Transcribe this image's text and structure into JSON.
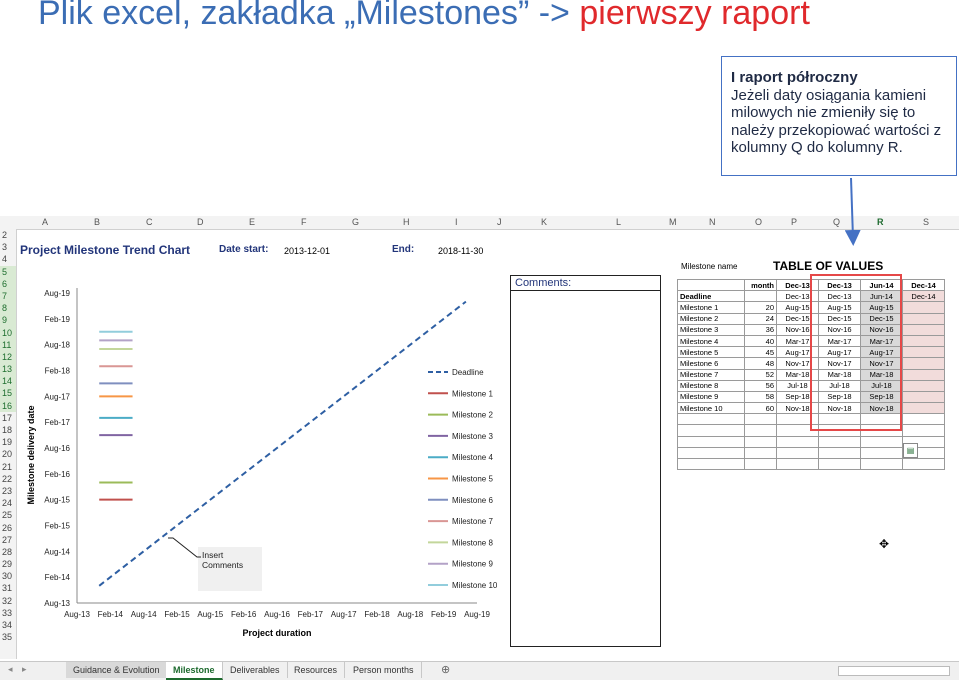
{
  "slide": {
    "title_part1": "Plik excel, zakładka „Milestones” -> ",
    "title_part2": "pierwszy raport"
  },
  "callout": {
    "heading": "I raport półroczny",
    "body": "Jeżeli daty osiągania kamieni milowych nie zmieniły się to należy przekopiować wartości z kolumny Q do kolumny R."
  },
  "columns": [
    "A",
    "B",
    "C",
    "D",
    "E",
    "F",
    "G",
    "H",
    "I",
    "J",
    "K",
    "L",
    "M",
    "N",
    "O",
    "P",
    "Q",
    "R",
    "S"
  ],
  "rows": [
    "2",
    "3",
    "4",
    "5",
    "6",
    "7",
    "8",
    "9",
    "10",
    "11",
    "12",
    "13",
    "14",
    "15",
    "16",
    "17",
    "18",
    "19",
    "20",
    "21",
    "22",
    "23",
    "24",
    "25",
    "26",
    "27",
    "28",
    "29",
    "30",
    "31",
    "32",
    "33",
    "34",
    "35"
  ],
  "sheet": {
    "chart_title": "Project Milestone Trend Chart",
    "date_start_label": "Date start:",
    "date_start_value": "2013-12-01",
    "end_label": "End:",
    "end_value": "2018-11-30",
    "comments_label": "Comments:",
    "milestone_name_label": "Milestone name",
    "table_title": "TABLE OF VALUES",
    "insert_comments": "Insert Comments"
  },
  "table": {
    "header": [
      "",
      "month",
      "Dec-13",
      "Dec-13",
      "Jun-14",
      "Dec-14"
    ],
    "rows": [
      {
        "name": "Deadline",
        "month": "",
        "c1": "Dec-13",
        "c2": "Dec-13",
        "c3": "Jun-14",
        "c4": "Dec-14"
      },
      {
        "name": "Milestone 1",
        "month": "20",
        "c1": "Aug-15",
        "c2": "Aug-15",
        "c3": "Aug-15",
        "c4": ""
      },
      {
        "name": "Milestone 2",
        "month": "24",
        "c1": "Dec-15",
        "c2": "Dec-15",
        "c3": "Dec-15",
        "c4": ""
      },
      {
        "name": "Milestone 3",
        "month": "36",
        "c1": "Nov-16",
        "c2": "Nov-16",
        "c3": "Nov-16",
        "c4": ""
      },
      {
        "name": "Milestone 4",
        "month": "40",
        "c1": "Mar-17",
        "c2": "Mar-17",
        "c3": "Mar-17",
        "c4": ""
      },
      {
        "name": "Milestone 5",
        "month": "45",
        "c1": "Aug-17",
        "c2": "Aug-17",
        "c3": "Aug-17",
        "c4": ""
      },
      {
        "name": "Milestone 6",
        "month": "48",
        "c1": "Nov-17",
        "c2": "Nov-17",
        "c3": "Nov-17",
        "c4": ""
      },
      {
        "name": "Milestone 7",
        "month": "52",
        "c1": "Mar-18",
        "c2": "Mar-18",
        "c3": "Mar-18",
        "c4": ""
      },
      {
        "name": "Milestone 8",
        "month": "56",
        "c1": "Jul-18",
        "c2": "Jul-18",
        "c3": "Jul-18",
        "c4": ""
      },
      {
        "name": "Milestone 9",
        "month": "58",
        "c1": "Sep-18",
        "c2": "Sep-18",
        "c3": "Sep-18",
        "c4": ""
      },
      {
        "name": "Milestone 10",
        "month": "60",
        "c1": "Nov-18",
        "c2": "Nov-18",
        "c3": "Nov-18",
        "c4": ""
      }
    ]
  },
  "chart_data": {
    "type": "line",
    "xlabel": "Project duration",
    "ylabel": "Milestone delivery date",
    "x_ticks": [
      "Aug-13",
      "Feb-14",
      "Aug-14",
      "Feb-15",
      "Aug-15",
      "Feb-16",
      "Aug-16",
      "Feb-17",
      "Aug-17",
      "Feb-18",
      "Aug-18",
      "Feb-19",
      "Aug-19"
    ],
    "y_ticks": [
      "Aug-13",
      "Feb-14",
      "Aug-14",
      "Feb-15",
      "Aug-15",
      "Feb-16",
      "Aug-16",
      "Feb-17",
      "Aug-17",
      "Feb-18",
      "Aug-18",
      "Feb-19",
      "Aug-19"
    ],
    "series": [
      {
        "name": "Deadline",
        "color": "#2e5fa3",
        "style": "dashed",
        "points": [
          [
            "Dec-13",
            "Dec-13"
          ],
          [
            "Jun-19",
            "Jun-19"
          ]
        ]
      },
      {
        "name": "Milestone 1",
        "color": "#c0504d",
        "points": [
          [
            "Dec-13",
            "Aug-15"
          ],
          [
            "Jun-14",
            "Aug-15"
          ]
        ]
      },
      {
        "name": "Milestone 2",
        "color": "#9bbb59",
        "points": [
          [
            "Dec-13",
            "Dec-15"
          ],
          [
            "Jun-14",
            "Dec-15"
          ]
        ]
      },
      {
        "name": "Milestone 3",
        "color": "#8064a2",
        "points": [
          [
            "Dec-13",
            "Nov-16"
          ],
          [
            "Jun-14",
            "Nov-16"
          ]
        ]
      },
      {
        "name": "Milestone 4",
        "color": "#4bacc6",
        "points": [
          [
            "Dec-13",
            "Mar-17"
          ],
          [
            "Jun-14",
            "Mar-17"
          ]
        ]
      },
      {
        "name": "Milestone 5",
        "color": "#f79646",
        "points": [
          [
            "Dec-13",
            "Aug-17"
          ],
          [
            "Jun-14",
            "Aug-17"
          ]
        ]
      },
      {
        "name": "Milestone 6",
        "color": "#7f8fbf",
        "points": [
          [
            "Dec-13",
            "Nov-17"
          ],
          [
            "Jun-14",
            "Nov-17"
          ]
        ]
      },
      {
        "name": "Milestone 7",
        "color": "#d99694",
        "points": [
          [
            "Dec-13",
            "Mar-18"
          ],
          [
            "Jun-14",
            "Mar-18"
          ]
        ]
      },
      {
        "name": "Milestone 8",
        "color": "#c3d69b",
        "points": [
          [
            "Dec-13",
            "Jul-18"
          ],
          [
            "Jun-14",
            "Jul-18"
          ]
        ]
      },
      {
        "name": "Milestone 9",
        "color": "#b3a2c7",
        "points": [
          [
            "Dec-13",
            "Sep-18"
          ],
          [
            "Jun-14",
            "Sep-18"
          ]
        ]
      },
      {
        "name": "Milestone 10",
        "color": "#92cddc",
        "points": [
          [
            "Dec-13",
            "Nov-18"
          ],
          [
            "Jun-14",
            "Nov-18"
          ]
        ]
      }
    ]
  },
  "tabs": [
    {
      "label": "Guidance & Evolution"
    },
    {
      "label": "Milestone"
    },
    {
      "label": "Deliverables"
    },
    {
      "label": "Resources"
    },
    {
      "label": "Person months"
    }
  ]
}
